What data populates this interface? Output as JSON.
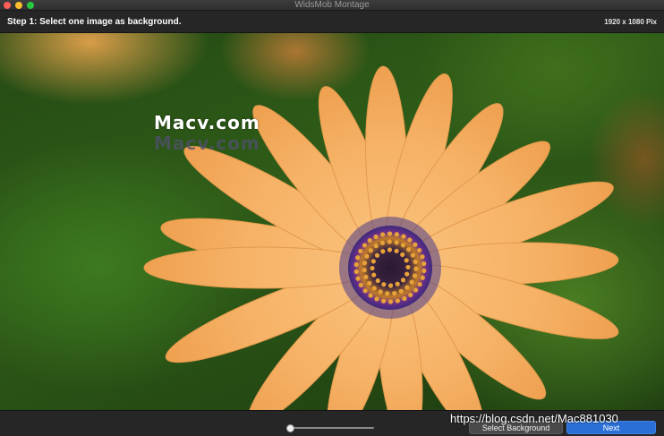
{
  "window": {
    "title": "WidsMob Montage"
  },
  "step": {
    "text": "Step 1: Select one image as background.",
    "dimensions": "1920 x 1080 Pix"
  },
  "canvas": {
    "watermark": "Macv.com",
    "watermark_shadow": "Macv.com"
  },
  "bottom": {
    "select_background_label": "Select Background",
    "next_label": "Next",
    "site_watermark": "https://blog.csdn.net/Mac881030"
  },
  "colors": {
    "accent_button": "#2a6fd6",
    "petal": "#f6b266",
    "leaf": "#3d7a1f"
  },
  "icons": {
    "close": "close-icon",
    "minimize": "minimize-icon",
    "maximize": "maximize-icon"
  }
}
